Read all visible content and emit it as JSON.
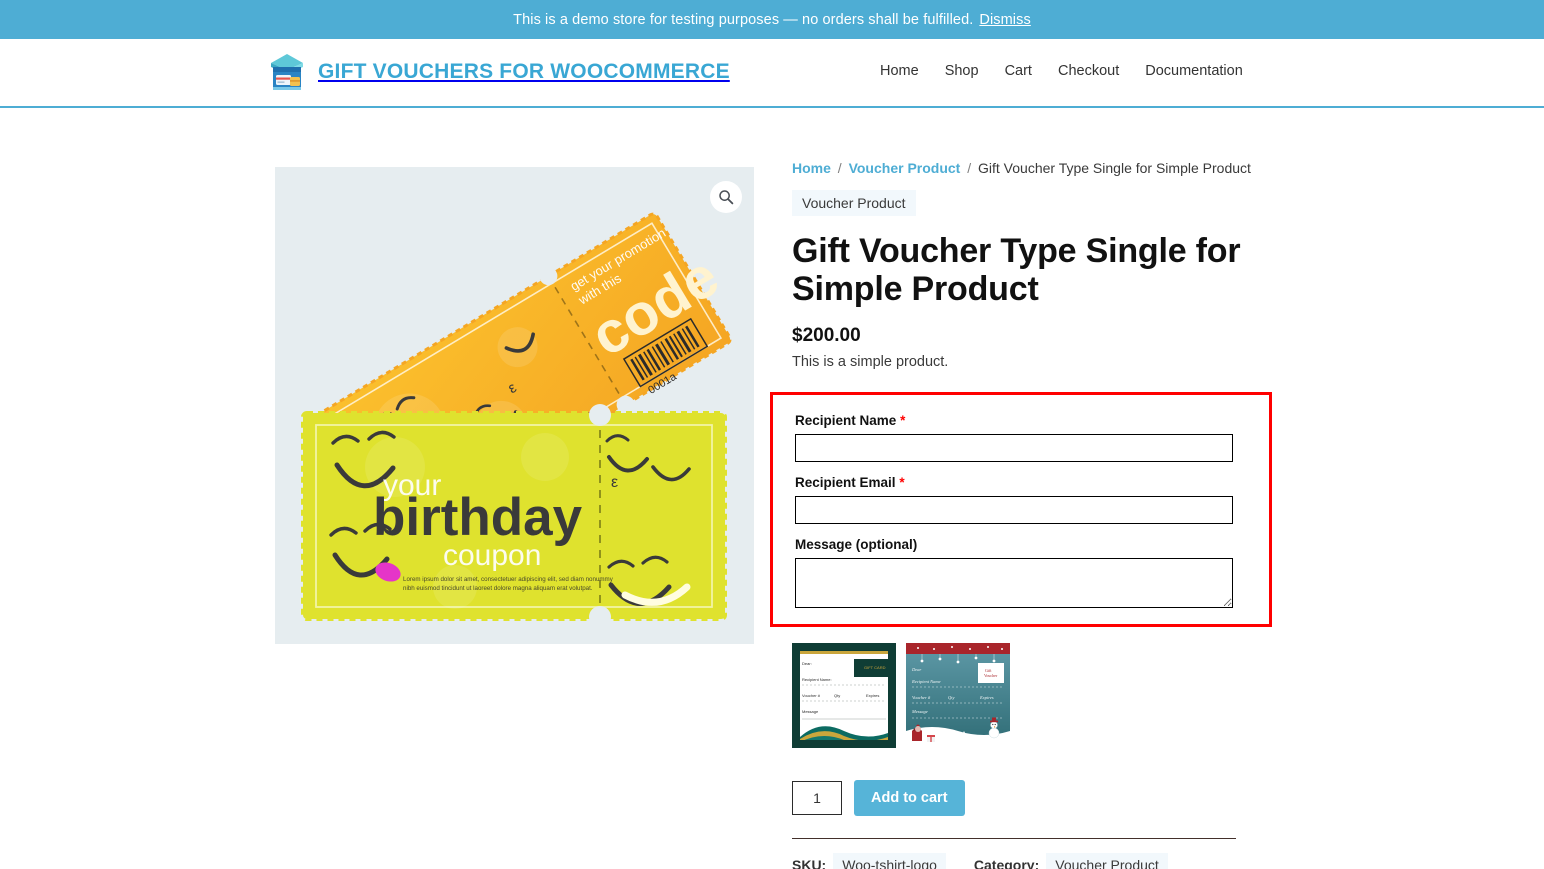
{
  "banner": {
    "message": "This is a demo store for testing purposes — no orders shall be fulfilled.",
    "dismiss_label": "Dismiss",
    "background": "#4eadd4"
  },
  "header": {
    "brand_title": "GIFT VOUCHERS FOR WOOCOMMERCE",
    "brand_color": "#39a7d4",
    "logo_icon": "shop-storefront-icon",
    "nav": [
      {
        "label": "Home"
      },
      {
        "label": "Shop"
      },
      {
        "label": "Cart"
      },
      {
        "label": "Checkout"
      },
      {
        "label": "Documentation"
      }
    ]
  },
  "gallery": {
    "zoom_icon": "magnifier-icon",
    "image_alt": "Birthday coupon tickets",
    "background": "#e6edf0",
    "coupon_top_text": {
      "promo_line_1": "get your promotion",
      "promo_line_2": "with this",
      "code_word": "code",
      "barcode_number": "0001a"
    },
    "coupon_bottom_text": {
      "line_1": "your",
      "line_2": "birthday",
      "line_3": "coupon",
      "fine_print": "Lorem ipsum dolor sit amet, consectetuer adipiscing elit, sed diam nonummy nibh euismod tincidunt ut laoreet dolore magna aliquam erat volutpat."
    }
  },
  "product": {
    "breadcrumb": {
      "home": "Home",
      "category": "Voucher Product",
      "current": "Gift Voucher Type Single for Simple Product",
      "separator": "/"
    },
    "category_tag": "Voucher Product",
    "title": "Gift Voucher Type Single for Simple Product",
    "price": "$200.00",
    "short_description": "This is a simple product.",
    "quantity": "1",
    "add_to_cart_label": "Add to cart",
    "add_to_cart_color": "#56b4d8",
    "sku_label": "SKU:",
    "sku_value": "Woo-tshirt-logo",
    "category_label": "Category:",
    "category_value": "Voucher Product"
  },
  "voucher_form": {
    "highlight_color": "#ff0000",
    "recipient_name": {
      "label": "Recipient Name",
      "required_marker": "*",
      "value": "",
      "placeholder": ""
    },
    "recipient_email": {
      "label": "Recipient Email",
      "required_marker": "*",
      "value": "",
      "placeholder": ""
    },
    "message": {
      "label": "Message (optional)",
      "value": "",
      "placeholder": ""
    }
  },
  "templates": [
    {
      "name": "dark-green-voucher-template",
      "alt": "Dark green gift voucher template"
    },
    {
      "name": "christmas-voucher-template",
      "alt": "Christmas winter gift voucher template"
    }
  ]
}
